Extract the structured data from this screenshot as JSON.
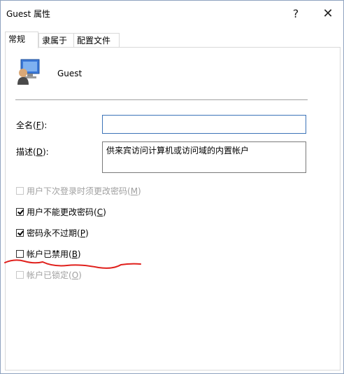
{
  "window": {
    "title": "Guest 属性",
    "help_glyph": "?",
    "close_glyph": "✕"
  },
  "tabs": [
    {
      "label": "常规",
      "active": true
    },
    {
      "label": "隶属于",
      "active": false
    },
    {
      "label": "配置文件",
      "active": false
    }
  ],
  "user": {
    "icon": "user-computer-icon",
    "name": "Guest"
  },
  "form": {
    "fullname": {
      "label": "全名(",
      "accel": "F",
      "suffix": "):",
      "value": ""
    },
    "description": {
      "label": "描述(",
      "accel": "D",
      "suffix": "):",
      "value": "供来宾访问计算机或访问域的内置帐户"
    }
  },
  "options": [
    {
      "text": "用户下次登录时须更改密码(",
      "accel": "M",
      "suffix": ")",
      "checked": false,
      "enabled": false
    },
    {
      "text": "用户不能更改密码(",
      "accel": "C",
      "suffix": ")",
      "checked": true,
      "enabled": true
    },
    {
      "text": "密码永不过期(",
      "accel": "P",
      "suffix": ")",
      "checked": true,
      "enabled": true
    },
    {
      "text": "帐户已禁用(",
      "accel": "B",
      "suffix": ")",
      "checked": false,
      "enabled": true
    },
    {
      "text": "帐户已锁定(",
      "accel": "O",
      "suffix": ")",
      "checked": false,
      "enabled": false
    }
  ],
  "annotation": {
    "color": "#e0201c"
  }
}
